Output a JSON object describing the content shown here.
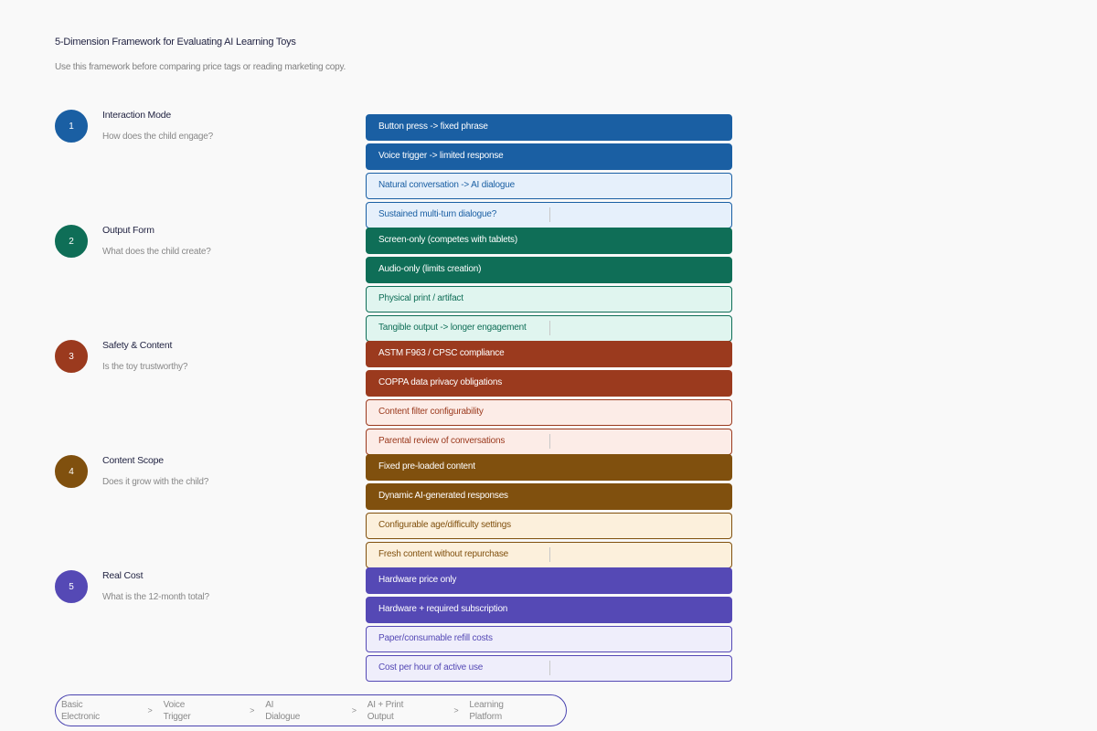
{
  "title": "5-Dimension Framework for Evaluating AI Learning Toys",
  "subtitle": "Use this framework before comparing price tags or reading marketing copy.",
  "dimensions": [
    {
      "number": "1",
      "name": "Interaction Mode",
      "question": "How does the child engage?",
      "color": "#1a5fa3",
      "light": "#e6f0fb",
      "options": [
        "Button press -> fixed phrase",
        "Voice trigger -> limited response",
        "Natural conversation -> AI dialogue",
        "Sustained multi-turn dialogue?"
      ]
    },
    {
      "number": "2",
      "name": "Output Form",
      "question": "What does the child create?",
      "color": "#0f6e57",
      "light": "#e0f5ef",
      "options": [
        "Screen-only (competes with tablets)",
        "Audio-only (limits creation)",
        "Physical print / artifact",
        "Tangible output -> longer engagement"
      ]
    },
    {
      "number": "3",
      "name": "Safety & Content",
      "question": "Is the toy trustworthy?",
      "color": "#9b3a1e",
      "light": "#fcece7",
      "options": [
        "ASTM F963 / CPSC compliance",
        "COPPA data privacy obligations",
        "Content filter configurability",
        "Parental review of conversations"
      ]
    },
    {
      "number": "4",
      "name": "Content Scope",
      "question": "Does it grow with the child?",
      "color": "#80500e",
      "light": "#fcf0dc",
      "options": [
        "Fixed pre-loaded content",
        "Dynamic AI-generated responses",
        "Configurable age/difficulty settings",
        "Fresh content without repurchase"
      ]
    },
    {
      "number": "5",
      "name": "Real Cost",
      "question": "What is the 12-month total?",
      "color": "#5549b5",
      "light": "#efeefb",
      "options": [
        "Hardware price only",
        "Hardware + required subscription",
        "Paper/consumable refill costs",
        "Cost per hour of active use"
      ]
    }
  ],
  "progression": {
    "stages": [
      "Basic\nElectronic",
      "Voice\nTrigger",
      "AI\nDialogue",
      "AI + Print\nOutput",
      "Learning\nPlatform"
    ],
    "separator": ">"
  }
}
